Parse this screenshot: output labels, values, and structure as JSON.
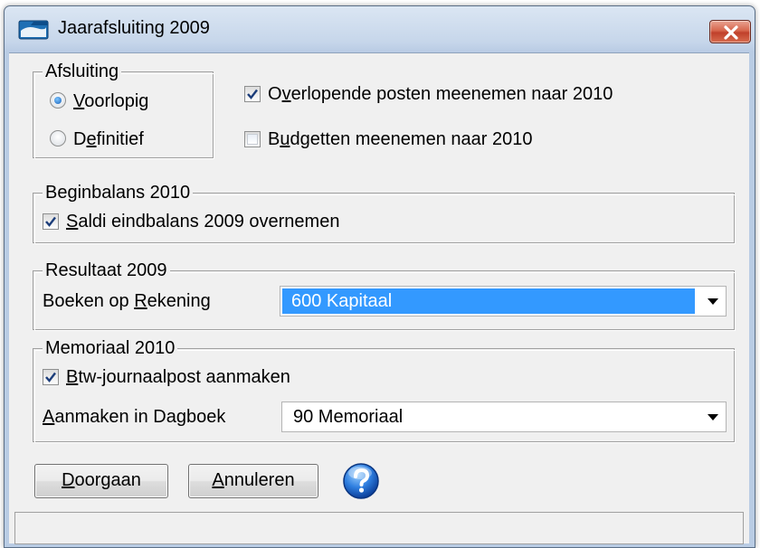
{
  "window": {
    "title": "Jaarafsluiting 2009",
    "icon": "folder-icon",
    "close_icon": "close-icon"
  },
  "afsluiting": {
    "legend": "Afsluiting",
    "options": [
      {
        "pre": "",
        "accel": "V",
        "post": "oorlopig",
        "selected": true
      },
      {
        "pre": "D",
        "accel": "e",
        "post": "finitief",
        "selected": false
      }
    ]
  },
  "options": {
    "overlopende": {
      "pre": "O",
      "accel": "v",
      "post": "erlopende posten meenemen naar 2010",
      "checked": true
    },
    "budgetten": {
      "pre": "B",
      "accel": "u",
      "post": "dgetten meenemen naar 2010",
      "checked": false
    }
  },
  "beginbalans": {
    "legend": "Beginbalans 2010",
    "saldi": {
      "pre": "",
      "accel": "S",
      "post": "aldi eindbalans 2009 overnemen",
      "checked": true
    }
  },
  "resultaat": {
    "legend": "Resultaat 2009",
    "label_pre": "Boeken op ",
    "label_accel": "R",
    "label_post": "ekening",
    "selected_value": "600 Kapitaal"
  },
  "memoriaal": {
    "legend": "Memoriaal 2010",
    "btw": {
      "pre": "",
      "accel": "B",
      "post": "tw-journaalpost aanmaken",
      "checked": true
    },
    "label_pre": "",
    "label_accel": "A",
    "label_post": "anmaken in Dagboek",
    "selected_value": "90 Memoriaal"
  },
  "buttons": {
    "doorgaan": {
      "pre": "",
      "accel": "D",
      "post": "oorgaan"
    },
    "annuleren": {
      "pre": "",
      "accel": "A",
      "post": "nnuleren"
    },
    "help_icon": "help-icon"
  },
  "colors": {
    "selection": "#3399ff",
    "check": "#1c3d7a",
    "close": "#c0402b"
  }
}
